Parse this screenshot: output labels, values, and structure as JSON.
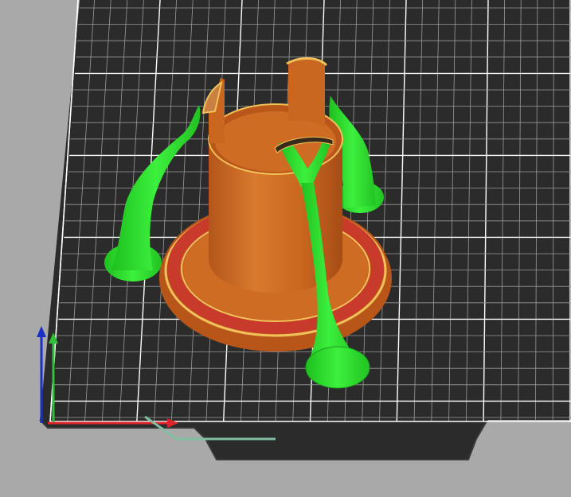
{
  "viewport": {
    "background": "#a9a9a9",
    "bed_color": "#2b2b2b",
    "grid_minor_color": "#9a9a9a",
    "grid_major_color": "#ffffff"
  },
  "model": {
    "body_color": "#c9661f",
    "body_highlight": "#f0b46b",
    "brim_red": "#c83a2a",
    "outline_yellow": "#f2c15a",
    "support_color": "#2edc2e",
    "support_dark": "#1a9e1a"
  },
  "axes": {
    "x_color": "#d8262b",
    "y_color": "#2fbf39",
    "z_color": "#1a2fc8"
  },
  "travel_line_color": "#7fbfa0",
  "icons": [
    "axis-x-arrow-icon",
    "axis-y-arrow-icon",
    "axis-z-arrow-icon"
  ]
}
